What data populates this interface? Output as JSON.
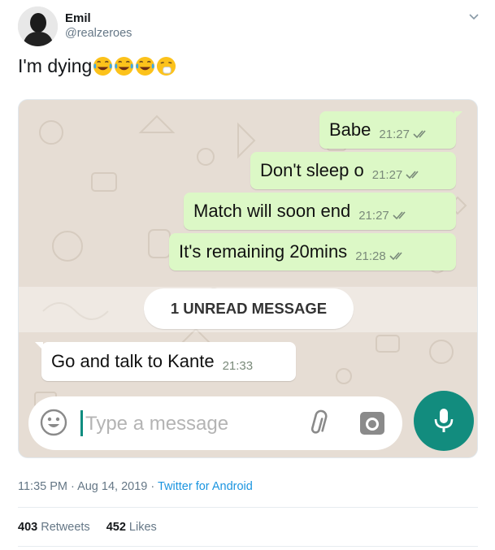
{
  "user": {
    "name": "Emil",
    "handle": "@realzeroes"
  },
  "tweet": {
    "text": "I'm dying",
    "emojis": [
      "tears-of-joy-emoji",
      "tears-of-joy-emoji",
      "tears-of-joy-emoji",
      "sneezing-face-emoji"
    ]
  },
  "chat": {
    "outgoing": [
      {
        "text": "Babe",
        "time": "21:27"
      },
      {
        "text": "Don't sleep o",
        "time": "21:27"
      },
      {
        "text": "Match will soon end",
        "time": "21:27"
      },
      {
        "text": "It's remaining 20mins",
        "time": "21:28"
      }
    ],
    "unread_label": "1 UNREAD MESSAGE",
    "incoming": [
      {
        "text": "Go and talk to Kante",
        "time": "21:33"
      }
    ],
    "input_placeholder": "Type a message"
  },
  "meta": {
    "timestamp": "11:35 PM · Aug 14, 2019 · ",
    "source": "Twitter for Android"
  },
  "stats": {
    "retweets_count": "403",
    "retweets_label": "Retweets",
    "likes_count": "452",
    "likes_label": "Likes"
  },
  "colors": {
    "outgoing_bubble": "#dcf8c6",
    "wallpaper": "#e6ddd4",
    "accent": "#128c7e",
    "link": "#1b95e0"
  }
}
